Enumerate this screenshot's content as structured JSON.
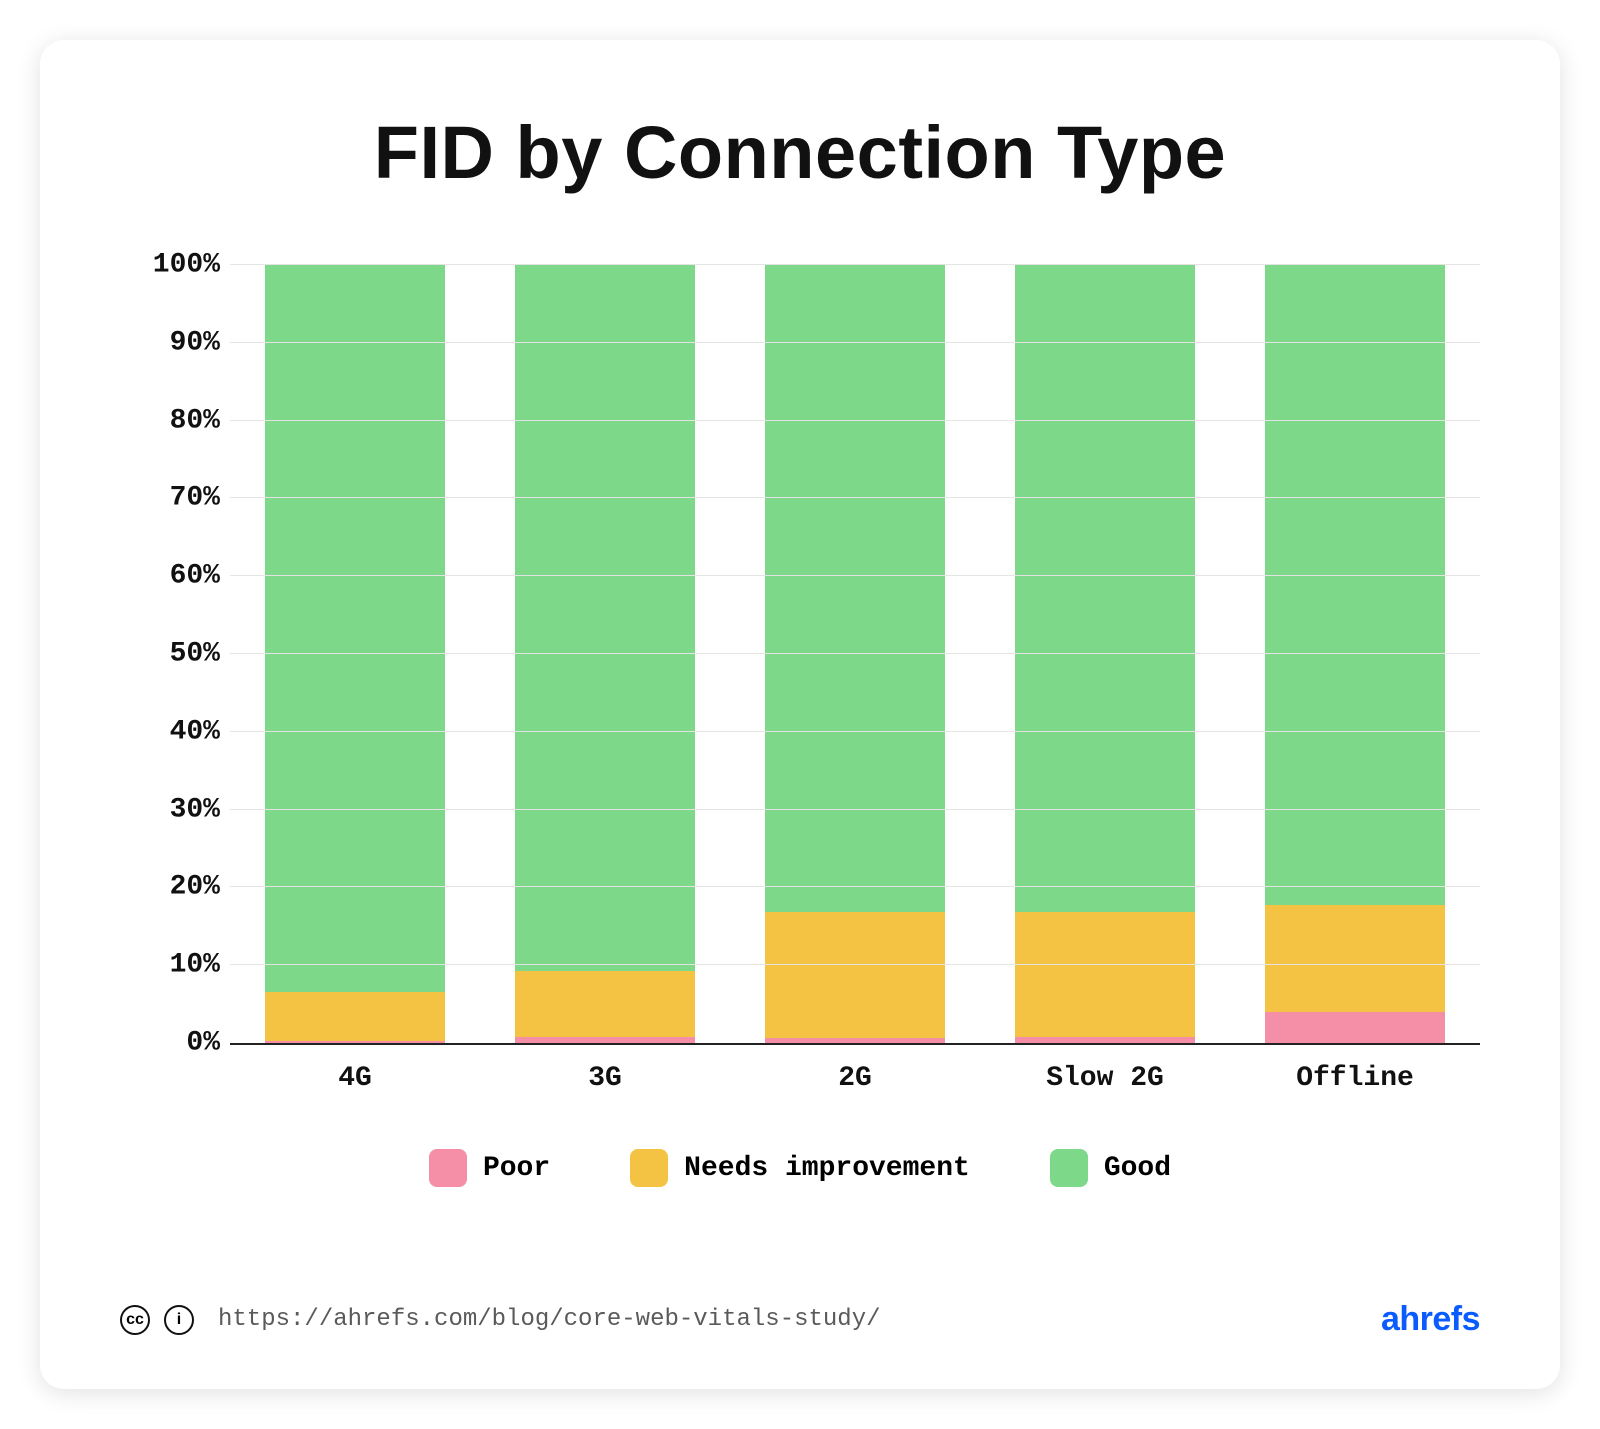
{
  "chart_data": {
    "type": "bar",
    "stacked": true,
    "title": "FID by Connection Type",
    "categories": [
      "4G",
      "3G",
      "2G",
      "Slow 2G",
      "Offline"
    ],
    "series": [
      {
        "name": "Poor",
        "color": "#f58fa8",
        "values": [
          0.3,
          0.8,
          0.6,
          0.8,
          4.0
        ]
      },
      {
        "name": "Needs improvement",
        "color": "#f5c344",
        "values": [
          6.2,
          8.5,
          16.2,
          16.0,
          13.8
        ]
      },
      {
        "name": "Good",
        "color": "#7dd88a",
        "values": [
          93.5,
          90.7,
          83.2,
          83.2,
          82.2
        ]
      }
    ],
    "ylabel": "",
    "xlabel": "",
    "ylim": [
      0,
      100
    ],
    "yticks": [
      0,
      10,
      20,
      30,
      40,
      50,
      60,
      70,
      80,
      90,
      100
    ],
    "ytick_labels": [
      "0%",
      "10%",
      "20%",
      "30%",
      "40%",
      "50%",
      "60%",
      "70%",
      "80%",
      "90%",
      "100%"
    ]
  },
  "legend": [
    {
      "label": "Poor",
      "color": "#f58fa8"
    },
    {
      "label": "Needs improvement",
      "color": "#f5c344"
    },
    {
      "label": "Good",
      "color": "#7dd88a"
    }
  ],
  "footer": {
    "cc": "cc",
    "by": "i",
    "url": "https://ahrefs.com/blog/core-web-vitals-study/",
    "brand": "ahrefs"
  }
}
